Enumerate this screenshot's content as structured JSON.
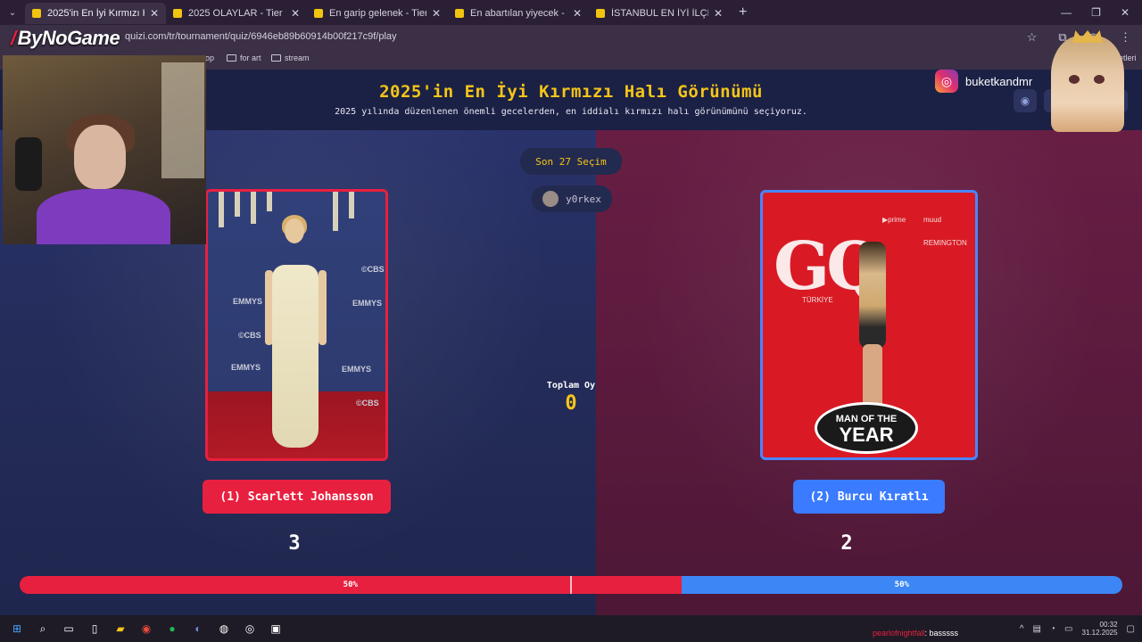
{
  "browser": {
    "tabs": [
      {
        "title": "2025'in En İyi Kırmızı Halı Görün",
        "active": true
      },
      {
        "title": "2025 OLAYLAR - Tier List | Kör",
        "active": false
      },
      {
        "title": "En garip gelenek - Tier List | Kü",
        "active": false
      },
      {
        "title": "En abartılan yiyecek - Tier List |",
        "active": false
      },
      {
        "title": "İSTANBUL EN İYİ İLÇESİ - Tier Li",
        "active": false
      }
    ],
    "url": "quizi.com/tr/tournament/quiz/6946eb89b60914b00f217c9f/play",
    "bookmarks": [
      "op",
      "for art",
      "stream"
    ],
    "bookmarks_right": "etleri"
  },
  "page": {
    "title": "2025'in En İyi Kırmızı Halı Görünümü",
    "subtitle": "2025 yılında düzenlenen önemli gecelerden, en iddialı kırmızı halı görünümünü seçiyoruz.",
    "recent_label": "Son 27 Seçim",
    "username": "y0rkex",
    "total_votes_label": "Toplam Oy",
    "total_votes": "0",
    "left": {
      "name": "(1) Scarlett Johansson",
      "votes": "3",
      "percent_label": "50%",
      "photo_texts": [
        "EMMYS",
        "EMMYS",
        "EMMYS",
        "EMMYS",
        "©CBS",
        "©CBS",
        "©CBS"
      ]
    },
    "right": {
      "name": "(2) Burcu Kıratlı",
      "votes": "2",
      "percent_label": "50%",
      "photo_texts": [
        "GQ",
        "▶prime",
        "muud",
        "REMINGTON",
        "TÜRKİYE",
        "MAN OF THE",
        "YEAR"
      ]
    },
    "bar_split_fraction": 0.6
  },
  "overlay": {
    "brand": "ByNoGame",
    "instagram_handle": "buketkandmr",
    "chat_user": "pearlofnightfall",
    "chat_text": ": basssss"
  },
  "taskbar": {
    "time": "00:32",
    "date": "31.12.2025"
  },
  "colors": {
    "accent_yellow": "#f5c518",
    "left_red": "#e8203f",
    "right_blue": "#3a7bff"
  }
}
